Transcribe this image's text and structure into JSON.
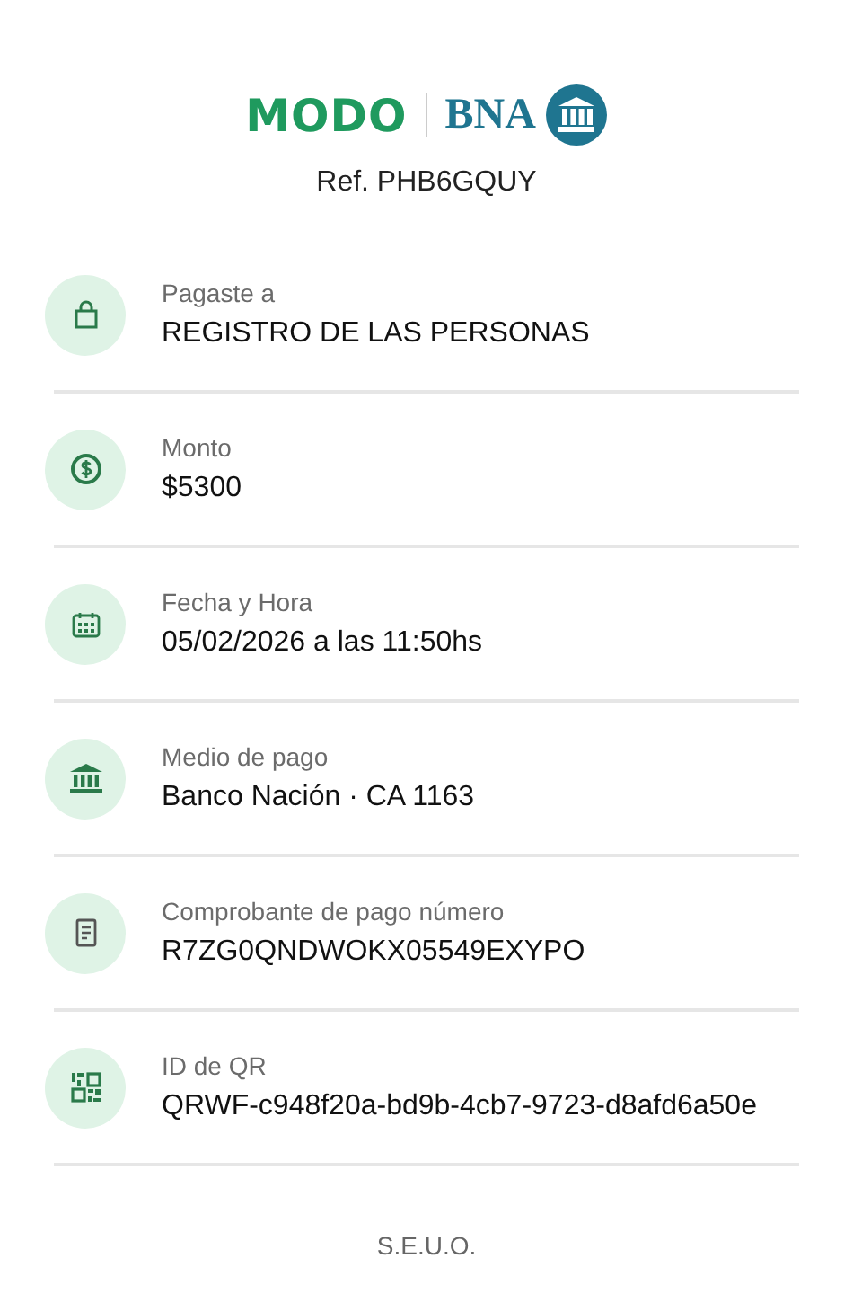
{
  "header": {
    "brand": "MODO",
    "bank": "BNA",
    "reference": "Ref. PHB6GQUY"
  },
  "rows": [
    {
      "kind": "bag",
      "label": "Pagaste a",
      "value": "REGISTRO DE LAS PERSONAS"
    },
    {
      "kind": "dollar",
      "label": "Monto",
      "value": "$5300"
    },
    {
      "kind": "calendar",
      "label": "Fecha y Hora",
      "value": "05/02/2026 a las 11:50hs"
    },
    {
      "kind": "bank",
      "label": "Medio de pago",
      "value": "Banco Nación · CA 1163"
    },
    {
      "kind": "receipt",
      "label": "Comprobante de pago número",
      "value": "R7ZG0QNDWOKX05549EXYPO"
    },
    {
      "kind": "qr",
      "label": "ID de QR",
      "value": "QRWF-c948f20a-bd9b-4cb7-9723-d8afd6a50e"
    }
  ],
  "footer": "S.E.U.O."
}
